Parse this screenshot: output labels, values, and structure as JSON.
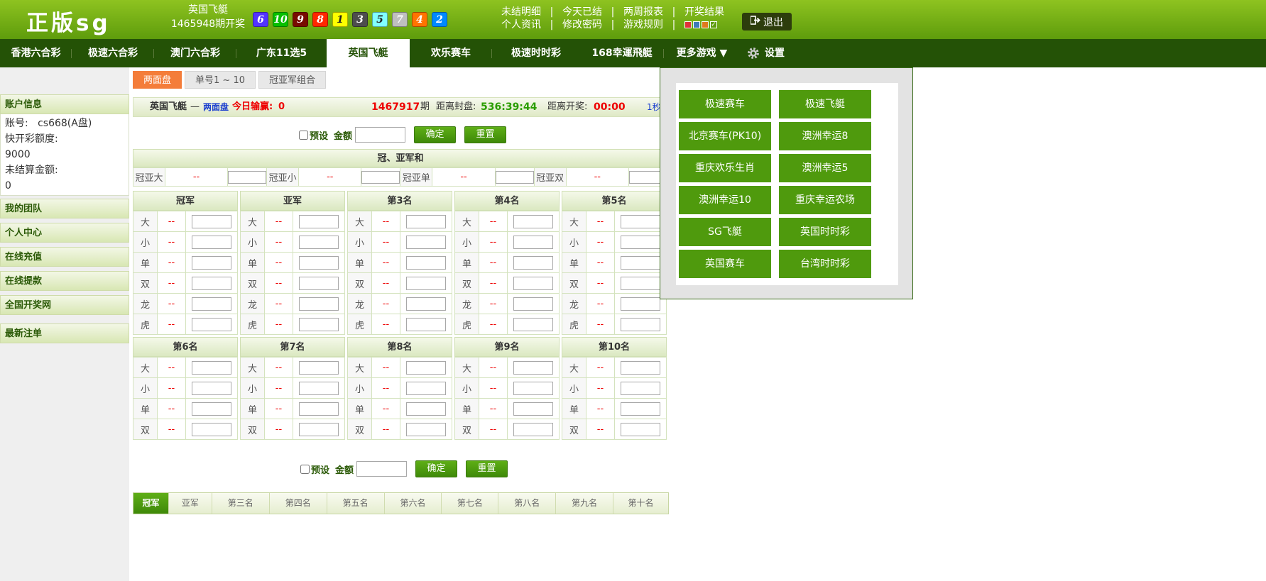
{
  "header": {
    "logo": "正版sg",
    "game_name": "英国飞艇",
    "draw_info": "1465948期开奖",
    "balls": [
      "6",
      "10",
      "9",
      "8",
      "1",
      "3",
      "5",
      "7",
      "4",
      "2"
    ],
    "links_row1": [
      "未结明细",
      "今天已结",
      "两周报表",
      "开奖结果"
    ],
    "links_row2": [
      "个人资讯",
      "修改密码",
      "游戏规则"
    ],
    "logout": "退出",
    "colors": {
      "brand": "#5e9c0c",
      "nav": "#245206",
      "accent": "#f47d3a",
      "odds": "#e00000"
    }
  },
  "nav": {
    "items": [
      "香港六合彩",
      "极速六合彩",
      "澳门六合彩",
      "广东11选5",
      "英国飞艇",
      "欢乐赛车",
      "极速时时彩",
      "168幸運飛艇",
      "更多游戏 ▼"
    ],
    "settings": "设置"
  },
  "sidebar": {
    "account_title": "账户信息",
    "account_label": "账号:",
    "account_value": "cs668(A盘)",
    "quota_label": "快开彩额度:",
    "quota_value": "9000",
    "unsettled_label": "未结算金额:",
    "unsettled_value": "0",
    "menu": [
      "我的团队",
      "个人中心",
      "在线充值",
      "在线提款",
      "全国开奖网",
      "最新注单"
    ]
  },
  "subtabs": [
    "两面盘",
    "单号1 ~ 10",
    "冠亚军组合"
  ],
  "infobar": {
    "game": "英国飞艇",
    "dash": "—",
    "mode": "两面盘",
    "today_label": "今日输赢:",
    "today_value": "0",
    "period": "1467917",
    "period_suffix": "期",
    "close_label": "距离封盘:",
    "close_value": "536:39:44",
    "open_label": "距离开奖:",
    "open_value": "00:00",
    "refresh": "1秒"
  },
  "form": {
    "preset": "预设",
    "amount": "金额",
    "confirm": "确定",
    "reset": "重置"
  },
  "sum_section": {
    "title": "冠、亚军和",
    "items": [
      {
        "label": "冠亚大",
        "odds": "--"
      },
      {
        "label": "冠亚小",
        "odds": "--"
      },
      {
        "label": "冠亚单",
        "odds": "--"
      },
      {
        "label": "冠亚双",
        "odds": "--"
      }
    ]
  },
  "positions_top": [
    {
      "title": "冠军",
      "rows": [
        "大",
        "小",
        "单",
        "双",
        "龙",
        "虎"
      ]
    },
    {
      "title": "亚军",
      "rows": [
        "大",
        "小",
        "单",
        "双",
        "龙",
        "虎"
      ]
    },
    {
      "title": "第3名",
      "rows": [
        "大",
        "小",
        "单",
        "双",
        "龙",
        "虎"
      ]
    },
    {
      "title": "第4名",
      "rows": [
        "大",
        "小",
        "单",
        "双",
        "龙",
        "虎"
      ]
    },
    {
      "title": "第5名",
      "rows": [
        "大",
        "小",
        "单",
        "双",
        "龙",
        "虎"
      ]
    }
  ],
  "positions_bottom": [
    {
      "title": "第6名",
      "rows": [
        "大",
        "小",
        "单",
        "双"
      ]
    },
    {
      "title": "第7名",
      "rows": [
        "大",
        "小",
        "单",
        "双"
      ]
    },
    {
      "title": "第8名",
      "rows": [
        "大",
        "小",
        "单",
        "双"
      ]
    },
    {
      "title": "第9名",
      "rows": [
        "大",
        "小",
        "单",
        "双"
      ]
    },
    {
      "title": "第10名",
      "rows": [
        "大",
        "小",
        "单",
        "双"
      ]
    }
  ],
  "odds_placeholder": "--",
  "bottom_tabs": [
    "冠军",
    "亚军",
    "第三名",
    "第四名",
    "第五名",
    "第六名",
    "第七名",
    "第八名",
    "第九名",
    "第十名"
  ],
  "more_games": [
    "极速赛车",
    "极速飞艇",
    "北京赛车(PK10)",
    "澳洲幸运8",
    "重庆欢乐生肖",
    "澳洲幸运5",
    "澳洲幸运10",
    "重庆幸运农场",
    "SG飞艇",
    "英国时时彩",
    "英国赛车",
    "台湾时时彩"
  ]
}
